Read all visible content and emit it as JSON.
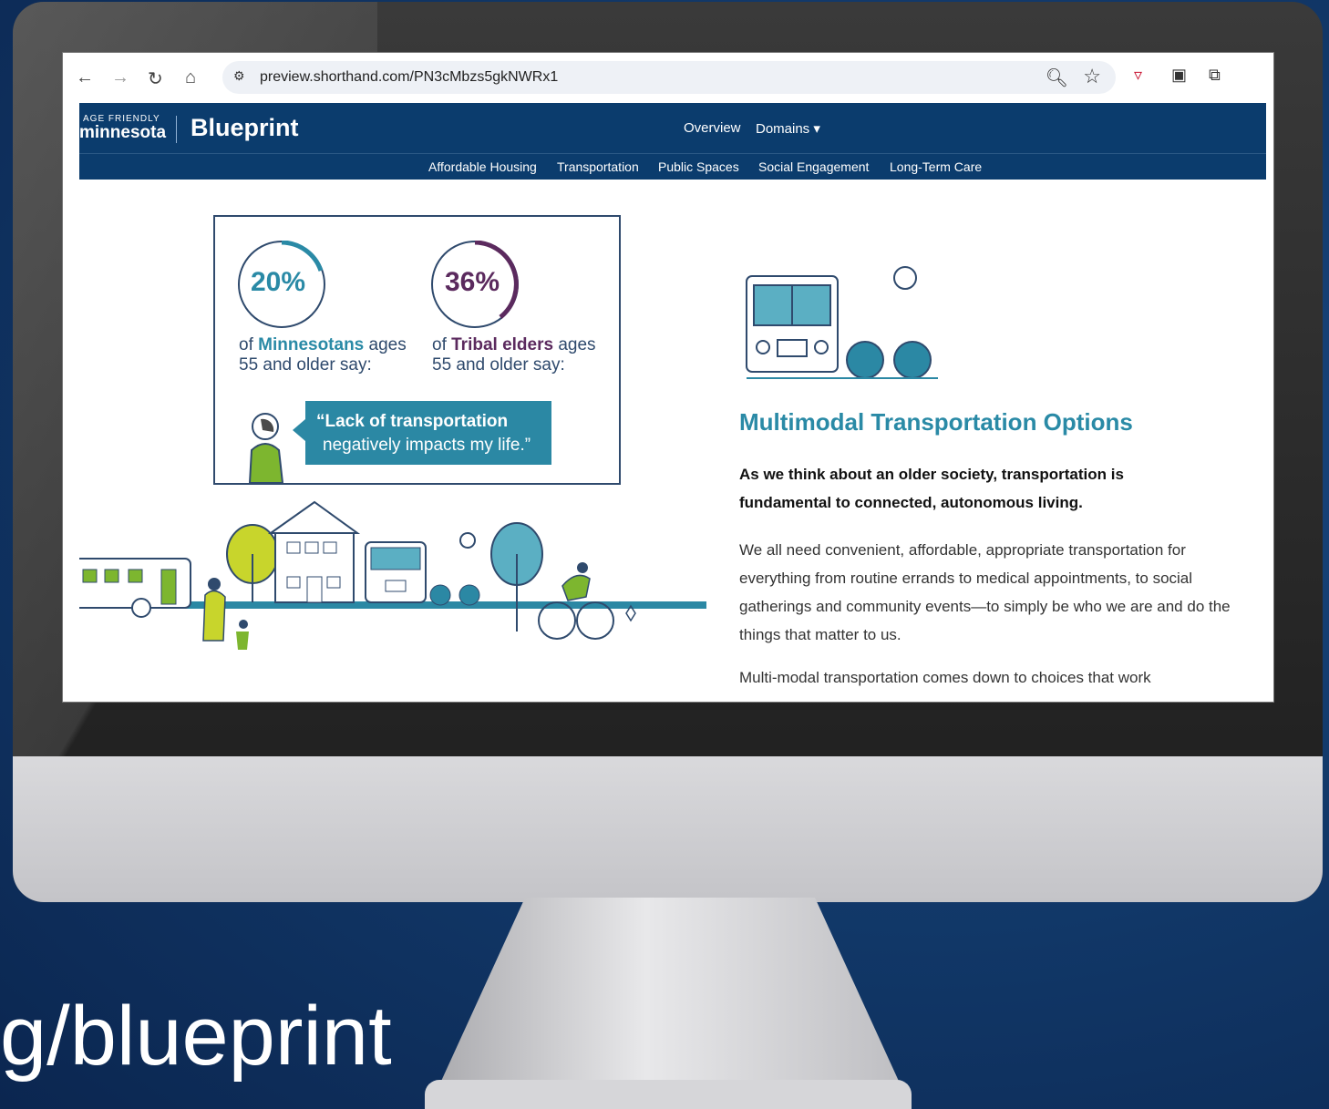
{
  "browser": {
    "url": "preview.shorthand.com/PN3cMbzs5gkNWRx1"
  },
  "site": {
    "logo_small": "AGE FRIENDLY",
    "logo_main": "minnesota",
    "logo_blueprint": "Blueprint",
    "menu": {
      "overview": "Overview",
      "domains": "Domains ▾"
    },
    "subnav": [
      "Affordable Housing",
      "Transportation",
      "Public Spaces",
      "Social Engagement",
      "Long-Term Care"
    ]
  },
  "stats": {
    "stat1": {
      "percent": "20%",
      "pre": "of ",
      "group": "Minnesotans",
      "post": " ages",
      "line2": "55 and older say:",
      "color": "#2a8aa6"
    },
    "stat2": {
      "percent": "36%",
      "pre": "of ",
      "group": "Tribal elders",
      "post": " ages",
      "line2": "55 and older say:",
      "color": "#5b2a5e"
    },
    "quote_bold": "“Lack of transportation",
    "quote_rest": "negatively impacts my life.”"
  },
  "article": {
    "title": "Multimodal Transportation Options",
    "lead": "As we think about an older society, transportation is fundamental to connected, autonomous living.",
    "para1": "We all need convenient, affordable, appropriate transportation for everything from routine errands to medical appointments, to social gatherings and community events—to simply be who we are and do the things that matter to us.",
    "para2": "Multi-modal transportation comes down to choices that work"
  },
  "overlay_text": "g/blueprint",
  "colors": {
    "navy": "#0b3c6d",
    "teal": "#2a8aa6",
    "purple": "#5b2a5e",
    "green": "#7db62f"
  }
}
